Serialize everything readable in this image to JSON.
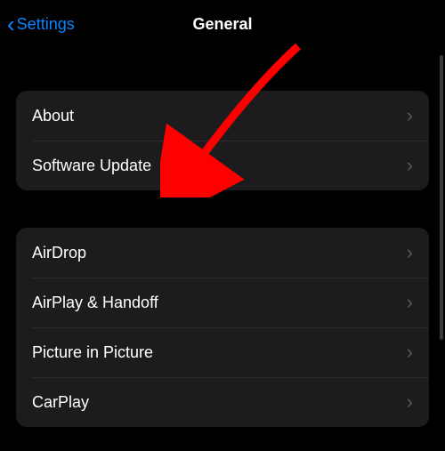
{
  "header": {
    "back_label": "Settings",
    "title": "General"
  },
  "groups": [
    {
      "rows": [
        {
          "label": "About"
        },
        {
          "label": "Software Update"
        }
      ]
    },
    {
      "rows": [
        {
          "label": "AirDrop"
        },
        {
          "label": "AirPlay & Handoff"
        },
        {
          "label": "Picture in Picture"
        },
        {
          "label": "CarPlay"
        }
      ]
    }
  ],
  "annotation": {
    "arrow_color": "#ff0000",
    "target": "Software Update"
  }
}
